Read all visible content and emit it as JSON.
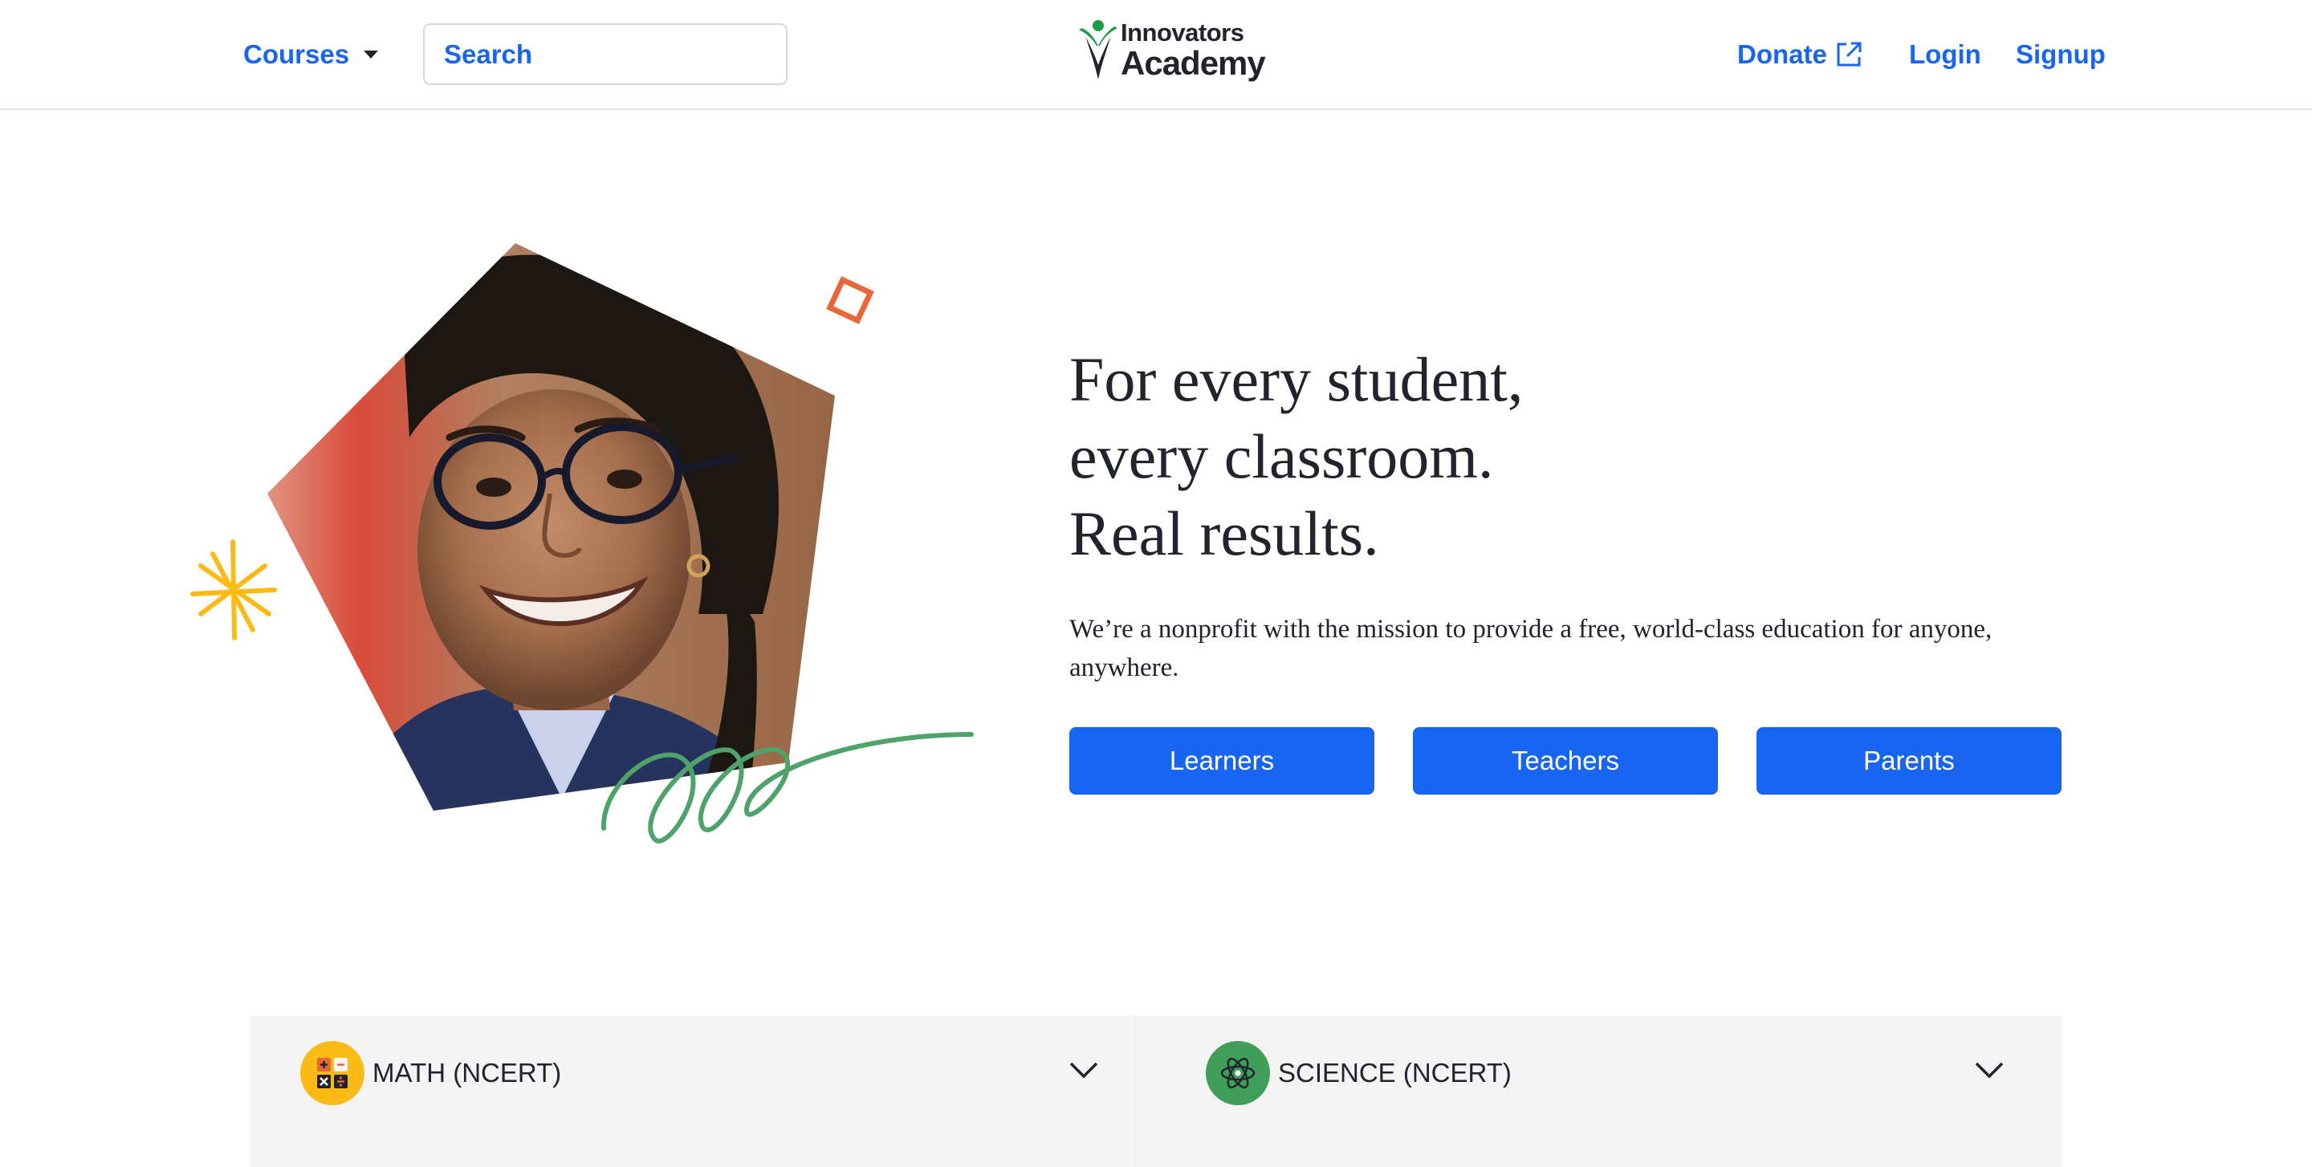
{
  "header": {
    "courses_label": "Courses",
    "search_placeholder": "Search",
    "logo": {
      "line1": "Innovators",
      "line2": "Academy"
    },
    "donate_label": "Donate",
    "login_label": "Login",
    "signup_label": "Signup"
  },
  "hero": {
    "title_lines": [
      "For every student,",
      "every classroom.",
      "Real results."
    ],
    "description": "We’re a nonprofit with the mission to provide a free, world-class education for anyone, anywhere.",
    "buttons": [
      "Learners",
      "Teachers",
      "Parents"
    ]
  },
  "subjects": [
    {
      "label": "MATH (NCERT)",
      "icon": "calculator-icon"
    },
    {
      "label": "SCIENCE (NCERT)",
      "icon": "atom-icon"
    }
  ],
  "colors": {
    "brand_blue": "#1865f2",
    "math_yellow": "#fbbb16",
    "science_green": "#3e9e5a",
    "logo_green": "#1f9b48",
    "accent_orange": "#e8663a"
  }
}
